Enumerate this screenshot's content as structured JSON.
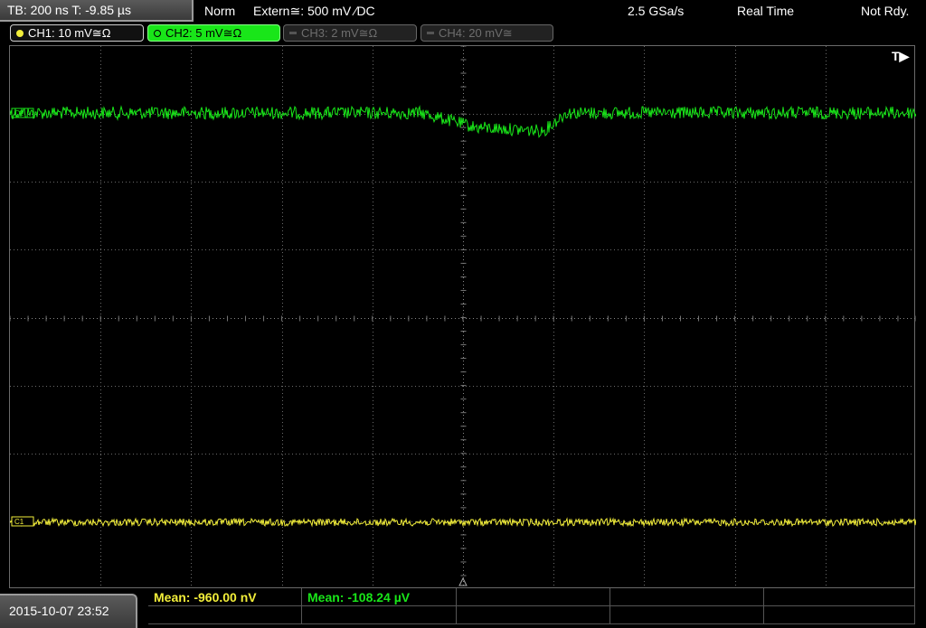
{
  "topbar": {
    "timebase": "TB: 200 ns   T: -9.85 µs",
    "mode": "Norm",
    "trigger": "Extern≅: 500 mV ∕DC",
    "sample_rate": "2.5 GSa/s",
    "acq_mode": "Real Time",
    "status": "Not Rdy."
  },
  "channels": [
    {
      "label": "CH1: 10 mV≅Ω",
      "color": "#f2ee3a"
    },
    {
      "label": "CH2: 5 mV≅Ω",
      "color": "#19e619"
    },
    {
      "label": "CH3: 2 mV≅Ω",
      "color": "#555555"
    },
    {
      "label": "CH4: 20 mV≅",
      "color": "#555555"
    }
  ],
  "plot": {
    "trigger_marker": "T▶",
    "ch2_marker": "C2",
    "ch1_marker": "C1"
  },
  "bottom": {
    "datetime": "2015-10-07 23:52",
    "measurements": [
      {
        "label": "Mean: -960.00 nV",
        "color": "#f2ee3a"
      },
      {
        "label": "Mean: -108.24 µV",
        "color": "#19e619"
      }
    ]
  },
  "colors": {
    "ch1": "#f2ee3a",
    "ch2": "#19e619",
    "grid": "#6a6a6a"
  }
}
